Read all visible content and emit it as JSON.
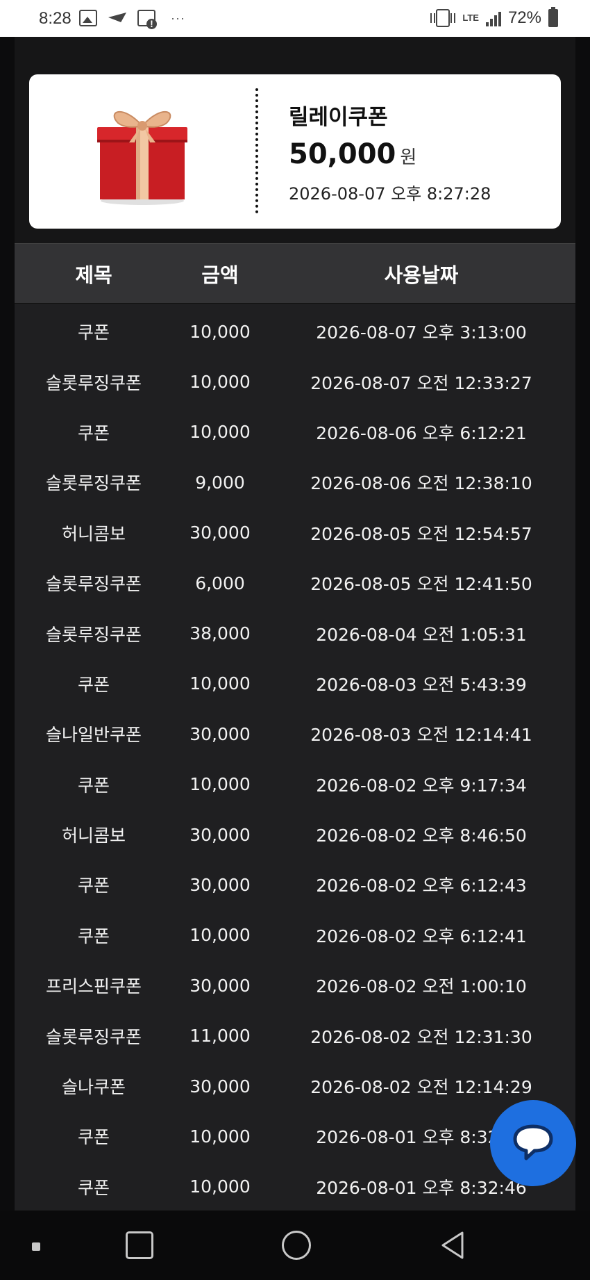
{
  "status_bar": {
    "time": "8:28",
    "dots": "···",
    "network": "LTE",
    "battery": "72%",
    "icons": [
      "gallery-icon",
      "send-icon",
      "message-alert-icon",
      "vibrate-icon",
      "signal-icon",
      "battery-icon"
    ]
  },
  "coupon": {
    "title": "릴레이쿠폰",
    "amount": "50,000",
    "unit": "원",
    "date": "2026-08-07 오후 8:27:28",
    "icon": "gift-box-icon"
  },
  "table": {
    "headers": [
      "제목",
      "금액",
      "사용날짜"
    ],
    "rows": [
      {
        "title": "쿠폰",
        "amount": "10,000",
        "date": "2026-08-07 오후 3:13:00"
      },
      {
        "title": "슬롯루징쿠폰",
        "amount": "10,000",
        "date": "2026-08-07 오전 12:33:27"
      },
      {
        "title": "쿠폰",
        "amount": "10,000",
        "date": "2026-08-06 오후 6:12:21"
      },
      {
        "title": "슬롯루징쿠폰",
        "amount": "9,000",
        "date": "2026-08-06 오전 12:38:10"
      },
      {
        "title": "허니콤보",
        "amount": "30,000",
        "date": "2026-08-05 오전 12:54:57"
      },
      {
        "title": "슬롯루징쿠폰",
        "amount": "6,000",
        "date": "2026-08-05 오전 12:41:50"
      },
      {
        "title": "슬롯루징쿠폰",
        "amount": "38,000",
        "date": "2026-08-04 오전 1:05:31"
      },
      {
        "title": "쿠폰",
        "amount": "10,000",
        "date": "2026-08-03 오전 5:43:39"
      },
      {
        "title": "슬나일반쿠폰",
        "amount": "30,000",
        "date": "2026-08-03 오전 12:14:41"
      },
      {
        "title": "쿠폰",
        "amount": "10,000",
        "date": "2026-08-02 오후 9:17:34"
      },
      {
        "title": "허니콤보",
        "amount": "30,000",
        "date": "2026-08-02 오후 8:46:50"
      },
      {
        "title": "쿠폰",
        "amount": "30,000",
        "date": "2026-08-02 오후 6:12:43"
      },
      {
        "title": "쿠폰",
        "amount": "10,000",
        "date": "2026-08-02 오후 6:12:41"
      },
      {
        "title": "프리스핀쿠폰",
        "amount": "30,000",
        "date": "2026-08-02 오전 1:00:10"
      },
      {
        "title": "슬롯루징쿠폰",
        "amount": "11,000",
        "date": "2026-08-02 오전 12:31:30"
      },
      {
        "title": "슬나쿠폰",
        "amount": "30,000",
        "date": "2026-08-02 오전 12:14:29"
      },
      {
        "title": "쿠폰",
        "amount": "10,000",
        "date": "2026-08-01 오후 8:32:46"
      },
      {
        "title": "쿠폰",
        "amount": "10,000",
        "date": "2026-08-01 오후 8:32:46"
      }
    ]
  },
  "chat_button": {
    "icon": "chat-bubble-icon",
    "color": "#1e6fe0"
  },
  "nav_bar": {
    "icons": [
      "accessibility-dot-icon",
      "recent-apps-icon",
      "home-icon",
      "back-icon"
    ]
  }
}
